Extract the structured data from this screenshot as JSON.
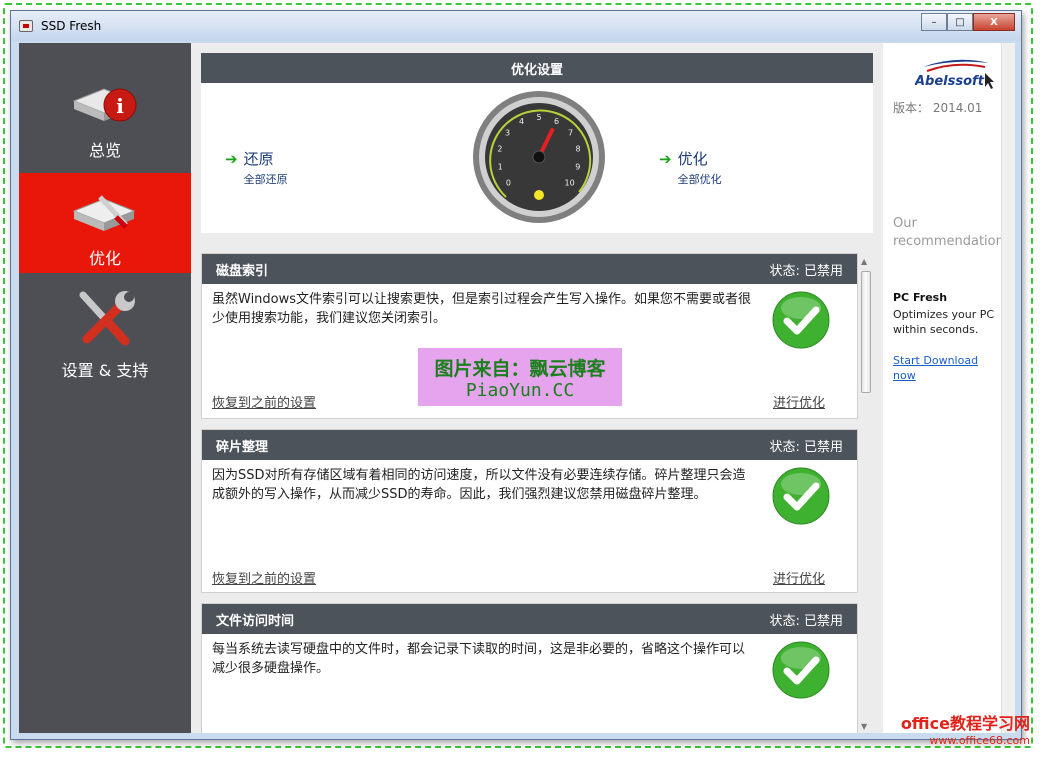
{
  "window": {
    "title": "SSD Fresh",
    "controls": {
      "minimize": "–",
      "maximize": "□",
      "close": "X"
    }
  },
  "sidebar": {
    "items": [
      {
        "label": "总览",
        "icon": "ssd-info-icon"
      },
      {
        "label": "优化",
        "icon": "ssd-optimize-icon",
        "active": true
      },
      {
        "label": "设置 & 支持",
        "icon": "tools-icon"
      }
    ]
  },
  "optimize_panel": {
    "title": "优化设置",
    "restore": {
      "title": "还原",
      "subtitle": "全部还原"
    },
    "optimize": {
      "title": "优化",
      "subtitle": "全部优化"
    },
    "gauge": {
      "ticks": [
        "0",
        "1",
        "2",
        "3",
        "4",
        "5",
        "6",
        "7",
        "8",
        "9",
        "10"
      ],
      "needle_value": 6
    }
  },
  "cards": [
    {
      "title": "磁盘索引",
      "status": "状态: 已禁用",
      "description": "虽然Windows文件索引可以让搜索更快，但是索引过程会产生写入操作。如果您不需要或者很少使用搜索功能，我们建议您关闭索引。",
      "restore_link": "恢复到之前的设置",
      "optimize_link": "进行优化"
    },
    {
      "title": "碎片整理",
      "status": "状态: 已禁用",
      "description": "因为SSD对所有存储区域有着相同的访问速度，所以文件没有必要连续存储。碎片整理只会造成额外的写入操作，从而减少SSD的寿命。因此，我们强烈建议您禁用磁盘碎片整理。",
      "restore_link": "恢复到之前的设置",
      "optimize_link": "进行优化"
    },
    {
      "title": "文件访问时间",
      "status": "状态: 已禁用",
      "description": "每当系统去读写硬盘中的文件时，都会记录下读取的时间，这是非必要的，省略这个操作可以减少很多硬盘操作。"
    }
  ],
  "right_panel": {
    "logo_text": "Abelssoft",
    "version": "版本： 2014.01",
    "recommendation": "Our recommendation:",
    "product_name": "PC Fresh",
    "product_desc": "Optimizes your PC within seconds.",
    "download_link": "Start Download now"
  },
  "watermarks": {
    "line1": "图片来自：飘云博客",
    "line2": "PiaoYun.CC",
    "line3": "office教程学习网",
    "line4": "www.office68.com"
  },
  "colors": {
    "active_red": "#e8170a",
    "sidebar_bg": "#4d4f55",
    "header_bg": "#4d535a",
    "link_blue": "#1a5fc8"
  }
}
